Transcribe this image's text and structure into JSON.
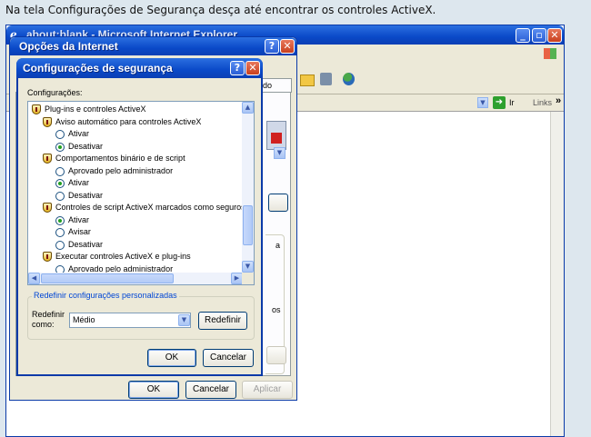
{
  "caption": "Na tela Configurações de Segurança desça até encontrar os controles ActiveX.",
  "browser": {
    "title": "about:blank - Microsoft Internet Explorer",
    "go_label": "Ir",
    "links_label": "Links",
    "chevron": "»"
  },
  "internet_options": {
    "title": "Opções da Internet",
    "tab_partial": "ado",
    "right_partial_a": "a",
    "right_partial_b": "os",
    "ok": "OK",
    "cancel": "Cancelar",
    "apply": "Aplicar"
  },
  "security_dialog": {
    "title": "Configurações de segurança",
    "settings_label": "Configurações:",
    "tree": [
      {
        "type": "group",
        "label": "Plug-ins e controles ActiveX"
      },
      {
        "type": "setting",
        "label": "Aviso automático para controles ActiveX"
      },
      {
        "type": "option",
        "label": "Ativar",
        "selected": false
      },
      {
        "type": "option",
        "label": "Desativar",
        "selected": true
      },
      {
        "type": "setting",
        "label": "Comportamentos binário e de script"
      },
      {
        "type": "option",
        "label": "Aprovado pelo administrador",
        "selected": false
      },
      {
        "type": "option",
        "label": "Ativar",
        "selected": true
      },
      {
        "type": "option",
        "label": "Desativar",
        "selected": false
      },
      {
        "type": "setting",
        "label": "Controles de script ActiveX marcados como seguros pa"
      },
      {
        "type": "option",
        "label": "Ativar",
        "selected": true
      },
      {
        "type": "option",
        "label": "Avisar",
        "selected": false
      },
      {
        "type": "option",
        "label": "Desativar",
        "selected": false
      },
      {
        "type": "setting",
        "label": "Executar controles ActiveX e plug-ins"
      },
      {
        "type": "option",
        "label": "Aprovado pelo administrador",
        "selected": false
      }
    ],
    "reset_group_label": "Redefinir configurações personalizadas",
    "reset_to_label": "Redefinir como:",
    "reset_level": "Médio",
    "reset_button": "Redefinir",
    "ok": "OK",
    "cancel": "Cancelar"
  },
  "colors": {
    "xp_title_blue": "#0a49c8",
    "dialog_face": "#ece9d8",
    "close_red": "#c8401e",
    "page_bg": "#dde7ee"
  }
}
